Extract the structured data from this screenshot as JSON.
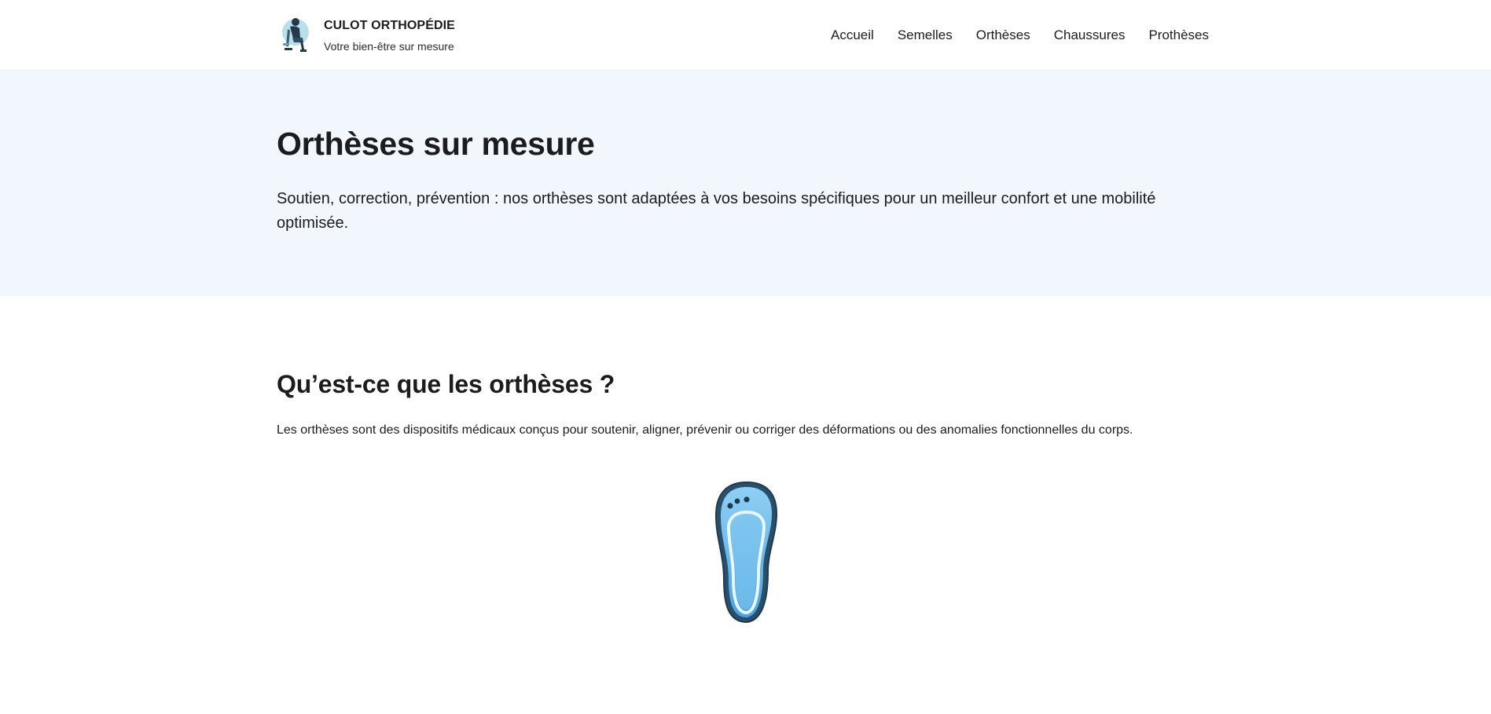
{
  "header": {
    "brand_name": "CULOT ORTHOPÉDIE",
    "tagline": "Votre bien-être sur mesure",
    "logo_icon": "orthopedic-seated-person-logo",
    "nav": [
      {
        "label": "Accueil"
      },
      {
        "label": "Semelles"
      },
      {
        "label": "Orthèses"
      },
      {
        "label": "Chaussures"
      },
      {
        "label": "Prothèses"
      }
    ]
  },
  "hero": {
    "title": "Orthèses sur mesure",
    "lead": "Soutien, correction, prévention : nos orthèses sont adaptées à vos besoins spécifiques pour un meilleur confort et une mobilité optimisée."
  },
  "section": {
    "title": "Qu’est-ce que les orthèses ?",
    "text": "Les orthèses sont des dispositifs médicaux conçus pour soutenir, aligner, prévenir ou corriger des déformations ou des anomalies fonctionnelles du corps.",
    "illustration_icon": "insole-icon"
  },
  "colors": {
    "hero_background": "#f2f7fd",
    "text": "#1c1c1e",
    "insole_blue": "#6cb8ec",
    "insole_outline": "#234a66"
  }
}
